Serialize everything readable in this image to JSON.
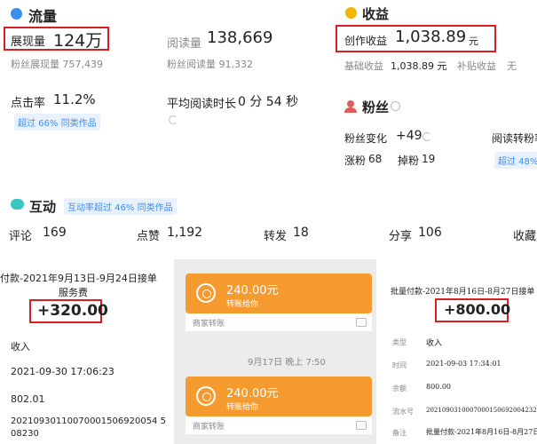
{
  "traffic": {
    "title": "流量",
    "impressions_label": "展现量",
    "impressions_value": "124万",
    "reads_label": "阅读量",
    "reads_value": "138,669",
    "fan_impressions": "粉丝展现量 757,439",
    "fan_reads": "粉丝阅读量 91,332",
    "ctr_label": "点击率",
    "ctr_value": "11.2%",
    "ctr_badge": "超过 66% 同类作品",
    "avg_label": "平均阅读时长",
    "avg_value": "0 分 54 秒"
  },
  "income": {
    "title": "收益",
    "creation_label": "创作收益",
    "creation_value": "1,038.89",
    "unit": "元",
    "base_label": "基础收益",
    "base_value": "1,038.89 元",
    "subsidy_label": "补贴收益",
    "subsidy_value": "无"
  },
  "fans": {
    "title": "粉丝",
    "change_label": "粉丝变化",
    "change_value": "+49",
    "read_convert": "阅读转粉率",
    "gain_label": "涨粉",
    "gain_value": "68",
    "lose_label": "掉粉",
    "lose_value": "19",
    "badge": "超过 48%"
  },
  "interaction": {
    "title": "互动",
    "badge": "互动率超过 46% 同类作品",
    "comments_label": "评论",
    "comments_value": "169",
    "likes_label": "点赞",
    "likes_value": "1,192",
    "shares_label": "转发",
    "shares_value": "18",
    "share2_label": "分享",
    "share2_value": "106",
    "favorites_label": "收藏"
  },
  "receipt_left": {
    "title_line1": "付款-2021年9月13日-9月24日接单",
    "title_line2": "服务费",
    "amount": "+320.00",
    "type": "收入",
    "time": "2021-09-30 17:06:23",
    "balance": "802.01",
    "serial_line1": "20210930110070001506920054 5",
    "serial_line2": "08230"
  },
  "chat": {
    "bubble1_amount": "240.00元",
    "bubble1_sub": "转账给你",
    "bubble1_foot": "商家转账",
    "timestamp": "9月17日 晚上 7:50",
    "bubble2_amount": "240.00元",
    "bubble2_sub": "转账给你",
    "bubble2_foot": "商家转账"
  },
  "receipt_right": {
    "title": "批量付款-2021年8月16日-8月27日接单",
    "amount": "+800.00",
    "type_label": "类型",
    "type_value": "收入",
    "time_label": "时间",
    "time_value": "2021-09-03 17:34:01",
    "balance_label": "余额",
    "balance_value": "800.00",
    "serial_label": "流水号",
    "serial_value": "20210903100070001506920042329473",
    "remark_label": "备注",
    "remark_value": "批量付款-2021年8月16日-8月27日"
  }
}
